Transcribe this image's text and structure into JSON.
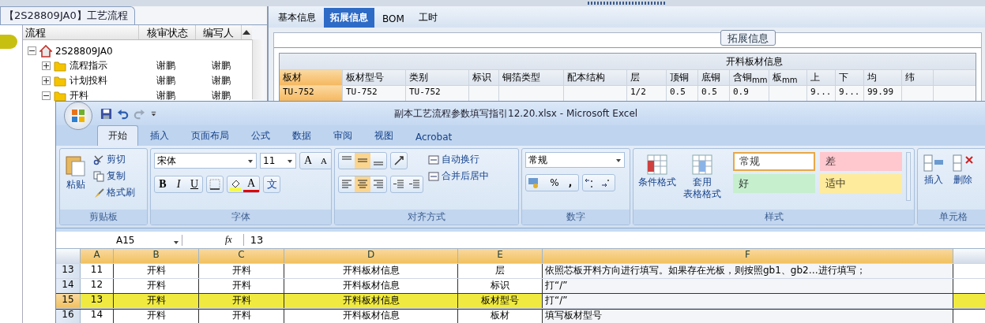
{
  "left_panel": {
    "title": "【2S28809JA0】工艺流程",
    "columns": [
      "流程",
      "核审状态",
      "编写人"
    ],
    "tree": [
      {
        "label": "2S28809JA0",
        "kind": "home",
        "expanded": true,
        "children": [
          {
            "label": "流程指示",
            "kind": "folder",
            "expanded": false,
            "review": "谢鹏",
            "author": "谢鹏"
          },
          {
            "label": "计划投料",
            "kind": "folder",
            "expanded": false,
            "review": "谢鹏",
            "author": "谢鹏"
          },
          {
            "label": "开料",
            "kind": "folder",
            "expanded": true,
            "review": "谢鹏",
            "author": "谢鹏"
          }
        ]
      }
    ]
  },
  "right_panel": {
    "tabs": [
      {
        "label": "基本信息",
        "selected": false
      },
      {
        "label": "拓展信息",
        "selected": true
      },
      {
        "label": "BOM",
        "selected": false
      },
      {
        "label": "工时",
        "selected": false
      }
    ],
    "group_title": "拓展信息",
    "table": {
      "caption": "开料板材信息",
      "columns": [
        {
          "label": "板材",
          "selected": true
        },
        {
          "label": "板材型号",
          "selected": false
        },
        {
          "label": "类别",
          "selected": false
        },
        {
          "label": "标识",
          "selected": false
        },
        {
          "label": "铜箔类型",
          "selected": false
        },
        {
          "label": "配本结构",
          "selected": false
        },
        {
          "label": "层",
          "selected": false
        },
        {
          "label": "顶铜",
          "selected": false
        },
        {
          "label": "底铜",
          "selected": false
        },
        {
          "label": "含铜$_{mm}$",
          "selected": false
        },
        {
          "label": "板$_{mm}$",
          "selected": false
        },
        {
          "label": "上",
          "selected": false
        },
        {
          "label": "下",
          "selected": false
        },
        {
          "label": "均",
          "selected": false
        },
        {
          "label": "纬",
          "selected": false
        }
      ],
      "rows": [
        [
          "TU-752",
          "TU-752",
          "TU-752",
          null,
          null,
          null,
          "1/2",
          "0.5",
          "0.5",
          "0.9",
          null,
          "9...",
          "9...",
          "99.99",
          null
        ]
      ]
    }
  },
  "excel": {
    "title": "副本工艺流程参数填写指引12.20.xlsx - Microsoft Excel",
    "tabs": [
      {
        "label": "开始",
        "selected": true
      },
      {
        "label": "插入",
        "selected": false
      },
      {
        "label": "页面布局",
        "selected": false
      },
      {
        "label": "公式",
        "selected": false
      },
      {
        "label": "数据",
        "selected": false
      },
      {
        "label": "审阅",
        "selected": false
      },
      {
        "label": "视图",
        "selected": false
      },
      {
        "label": "Acrobat",
        "selected": false
      }
    ],
    "ribbon": [
      {
        "kind": "clipboard",
        "title": "剪贴板",
        "big": "粘贴",
        "items": [
          "剪切",
          "复制",
          "格式刷"
        ]
      },
      {
        "kind": "font",
        "title": "字体",
        "font": "宋体",
        "size": "11",
        "grow": "A",
        "shrink": "A",
        "bold": "B",
        "italic": "I",
        "underline": "U",
        "font_color": "A",
        "phonetic": "文"
      },
      {
        "kind": "align",
        "title": "对齐方式",
        "items": [
          "自动换行",
          "合并后居中"
        ]
      },
      {
        "kind": "number",
        "title": "数字",
        "format": "常规",
        "symbols": [
          "%",
          ","
        ]
      },
      {
        "kind": "styles",
        "title": "样式",
        "buttons": [
          [
            "条件格式"
          ],
          [
            "套用",
            "表格格式"
          ]
        ],
        "gallery": [
          {
            "label": "常规",
            "color": "#ffffff",
            "selected": true
          },
          {
            "label": "差",
            "color": "#ffc7ce",
            "selected": false
          },
          {
            "label": "好",
            "color": "#c6efce",
            "selected": false
          },
          {
            "label": "适中",
            "color": "#ffeb9c",
            "selected": false
          }
        ]
      },
      {
        "kind": "cells",
        "title": "单元格",
        "buttons": [
          "插入",
          "删除"
        ]
      }
    ],
    "name_box": "A15",
    "fx": "fx",
    "formula": "13",
    "columns": [
      "A",
      "B",
      "C",
      "D",
      "E",
      "F"
    ],
    "rows": [
      {
        "number": "13",
        "selected": false,
        "cells": [
          "11",
          "开料",
          "开料",
          "开料板材信息",
          "层",
          "依照芯板开料方向进行填写。如果存在光板，则按照gb1、gb2…进行填写；"
        ]
      },
      {
        "number": "14",
        "selected": false,
        "cells": [
          "12",
          "开料",
          "开料",
          "开料板材信息",
          "标识",
          "打“/”"
        ]
      },
      {
        "number": "15",
        "selected": true,
        "cells": [
          "13",
          "开料",
          "开料",
          "开料板材信息",
          "板材型号",
          "打“/”"
        ]
      },
      {
        "number": "16",
        "selected": false,
        "cells": [
          "14",
          "开料",
          "开料",
          "开料板材信息",
          "板材",
          "填写板材型号"
        ]
      }
    ]
  }
}
